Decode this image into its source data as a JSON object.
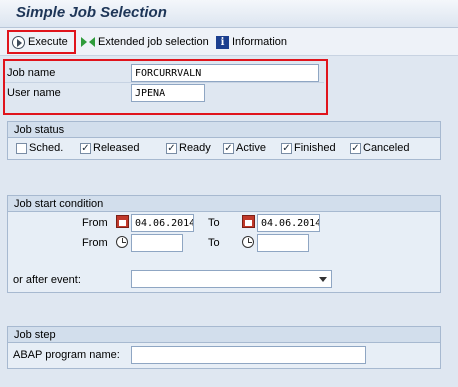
{
  "window": {
    "title": "Simple Job Selection"
  },
  "toolbar": {
    "execute_label": "Execute",
    "extended_label": "Extended job selection",
    "information_label": "Information"
  },
  "selection": {
    "job_name_label": "Job name",
    "job_name_value": "FORCURRVALN",
    "user_name_label": "User name",
    "user_name_value": "JPENA"
  },
  "job_status": {
    "title": "Job status",
    "items": [
      {
        "label": "Sched.",
        "checked": false
      },
      {
        "label": "Released",
        "checked": true
      },
      {
        "label": "Ready",
        "checked": true
      },
      {
        "label": "Active",
        "checked": true
      },
      {
        "label": "Finished",
        "checked": true
      },
      {
        "label": "Canceled",
        "checked": true
      }
    ]
  },
  "start_condition": {
    "title": "Job start condition",
    "from_label": "From",
    "to_label": "To",
    "from_date": "04.06.2014",
    "to_date": "04.06.2014",
    "from_time": "",
    "to_time": "",
    "event_label": "or after event:",
    "event_value": ""
  },
  "job_step": {
    "title": "Job step",
    "program_label": "ABAP program name:",
    "program_value": ""
  },
  "colors": {
    "highlight": "#e0141c",
    "title": "#1d3557"
  },
  "icons": [
    "execute-icon",
    "extended-selection-icon",
    "information-icon",
    "calendar-icon",
    "clock-icon"
  ]
}
